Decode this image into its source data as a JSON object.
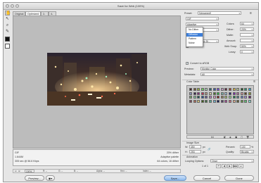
{
  "window": {
    "title": "Save for Web (100%)"
  },
  "tabs": [
    {
      "label": "Original"
    },
    {
      "label": "Optimized"
    },
    {
      "label": "2-Up"
    },
    {
      "label": "4-Up"
    }
  ],
  "preset": {
    "label": "Preset:",
    "value": "[Unnamed]",
    "format": "GIF",
    "reduction": "Adaptive",
    "dither_algo": "Diffusion",
    "colors_label": "Colors:",
    "colors_value": "64",
    "dither_label": "Dither:",
    "dither_value": "20%",
    "matte_label": "Matte:",
    "transparency_partial": "No Transparency Di...",
    "amount_label": "Amount:",
    "interlaced_label": "Interlaced",
    "websnap_label": "Web Snap:",
    "websnap_value": "50%",
    "lossy_label": "Lossy:",
    "lossy_value": "0"
  },
  "dither_menu": {
    "items": [
      "No Dither",
      "Diffusion",
      "Pattern",
      "Noise"
    ],
    "selected": "Diffusion"
  },
  "color": {
    "convert_label": "Convert to sRGB",
    "preview_label": "Preview:",
    "preview_value": "Monitor Color",
    "metadata_label": "Metadata:",
    "metadata_value": "All"
  },
  "color_table": {
    "label": "Color Table",
    "count": "64"
  },
  "image_size": {
    "label": "Image Size",
    "w_label": "W:",
    "w_value": "450",
    "h_label": "H:",
    "h_value": "253",
    "px": "px",
    "percent_label": "Percent:",
    "percent_value": "100",
    "quality_label": "Quality:",
    "quality_value": "Bicubic"
  },
  "animation": {
    "label": "Animation",
    "looping_label": "Looping Options:",
    "looping_value": "Once",
    "frame_counter": "1 of 1"
  },
  "info": {
    "format": "GIF",
    "size": "1.644M",
    "time": "305 sec @ 56.6 Kbps",
    "dither": "20% dither",
    "palette": "Adaptive palette",
    "colors": "64 colors, 16 dither"
  },
  "statusbar": {
    "zoom": "100%",
    "r": "R: --",
    "g": "G: --",
    "b": "B: --",
    "alpha": "Alpha: --",
    "hex": "Hex: --",
    "index": "Index: --"
  },
  "buttons": {
    "preview": "Preview...",
    "save": "Save...",
    "cancel": "Cancel",
    "done": "Done"
  },
  "colors": {
    "accent": "#3d7ed8",
    "canvas": "#bcbcbc",
    "panel": "#e6e6e6"
  }
}
